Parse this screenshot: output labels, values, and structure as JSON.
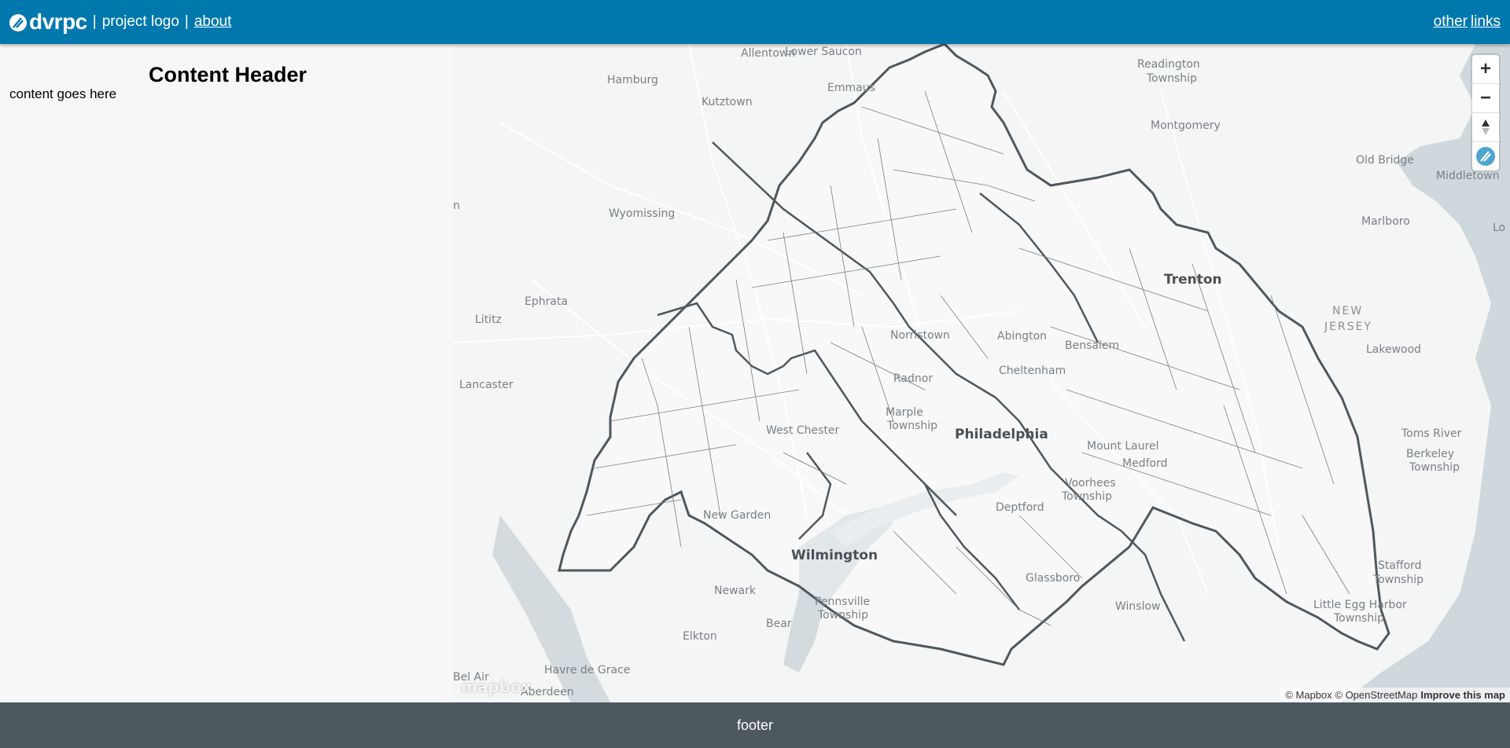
{
  "header": {
    "logo_text": "dvrpc",
    "project_logo": "project logo",
    "separator": "|",
    "about": "about",
    "other": "other",
    "links": "links"
  },
  "sidebar": {
    "content_header": "Content Header",
    "content_text": "content goes here"
  },
  "map": {
    "labels": {
      "allentown": "Allentown",
      "lower_saucon": "Lower Saucon",
      "readington": "Readington",
      "readington2": "Township",
      "hamburg": "Hamburg",
      "emmaus": "Emmaus",
      "kutztown": "Kutztown",
      "montgomery": "Montgomery",
      "old_bridge": "Old Bridge",
      "middletown": "Middletown",
      "wyomissing": "Wyomissing",
      "marlboro": "Marlboro",
      "lo": "Lo",
      "trenton": "Trenton",
      "ephrata": "Ephrata",
      "lititz": "Lititz",
      "new": "NEW",
      "jersey": "JERSEY",
      "norristown": "Norristown",
      "abington": "Abington",
      "bensalem": "Bensalem",
      "lakewood": "Lakewood",
      "cheltenham": "Cheltenham",
      "lancaster": "Lancaster",
      "radnor": "Radnor",
      "marple": "Marple",
      "marple2": "Township",
      "philadelphia": "Philadelphia",
      "toms_river": "Toms River",
      "west_chester": "West Chester",
      "mount_laurel": "Mount Laurel",
      "berkeley": "Berkeley",
      "berkeley2": "Township",
      "medford": "Medford",
      "voorhees": "Voorhees",
      "voorhees2": "Township",
      "deptford": "Deptford",
      "new_garden": "New Garden",
      "wilmington": "Wilmington",
      "stafford": "Stafford",
      "stafford2": "Township",
      "glassboro": "Glassboro",
      "newark": "Newark",
      "pennsville": "Pennsville",
      "pennsville2": "Township",
      "winslow": "Winslow",
      "little_egg": "Little Egg Harbor",
      "little_egg2": "Township",
      "bear": "Bear",
      "elkton": "Elkton",
      "havre": "Havre de Grace",
      "bel_air": "Bel Air",
      "aberdeen": "Aberdeen",
      "n": "n"
    },
    "zoom_in": "+",
    "zoom_out": "−",
    "mapbox_logo": "mapbox",
    "attribution": "© Mapbox © OpenStreetMap",
    "improve": "Improve this map"
  },
  "footer": {
    "text": "footer"
  },
  "colors": {
    "header_bg": "#0078ae",
    "footer_bg": "#4e585f",
    "boundary": "#4e585f",
    "water": "#cfd8dc"
  }
}
